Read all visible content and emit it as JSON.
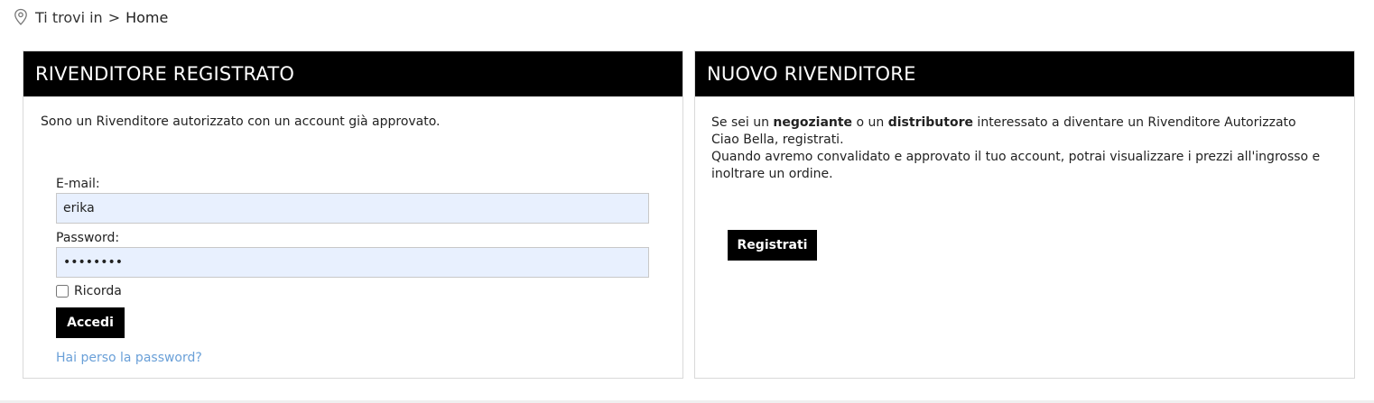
{
  "breadcrumb": {
    "prefix": "Ti trovi in",
    "separator": ">",
    "current": "Home"
  },
  "login_panel": {
    "title": "RIVENDITORE REGISTRATO",
    "intro": "Sono un Rivenditore autorizzato con un account già approvato.",
    "email_label": "E-mail:",
    "email_value": "erika",
    "password_label": "Password:",
    "password_value": "rivendit",
    "remember_label": "Ricorda",
    "remember_checked": false,
    "submit_label": "Accedi",
    "forgot_label": "Hai perso la password?"
  },
  "register_panel": {
    "title": "NUOVO RIVENDITORE",
    "text_1": "Se sei un ",
    "bold_1": "negoziante",
    "text_2": " o un ",
    "bold_2": "distributore",
    "text_3": " interessato a diventare un Rivenditore Autorizzato Ciao Bella, registrati.",
    "text_4": "Quando avremo convalidato e approvato il tuo account, potrai visualizzare i prezzi all'ingrosso e inoltrare un ordine.",
    "button_label": "Registrati"
  },
  "colors": {
    "header_bg": "#000000",
    "input_bg": "#e8f0fe",
    "link": "#6aa0d8"
  }
}
